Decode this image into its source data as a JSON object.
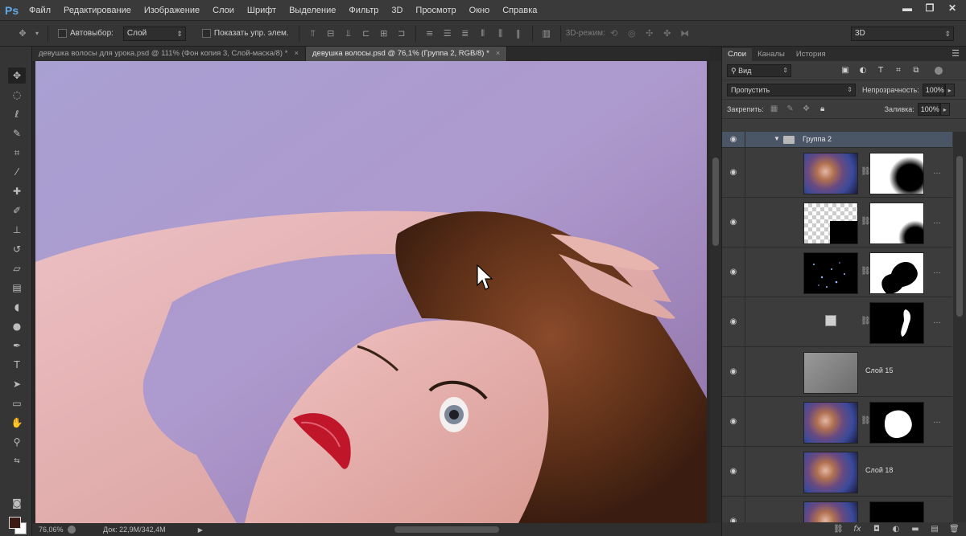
{
  "app": {
    "logo": "Ps"
  },
  "menu": [
    "Файл",
    "Редактирование",
    "Изображение",
    "Слои",
    "Шрифт",
    "Выделение",
    "Фильтр",
    "3D",
    "Просмотр",
    "Окно",
    "Справка"
  ],
  "window_controls": {
    "minimize": "▬",
    "restore": "❐",
    "close": "✕"
  },
  "options": {
    "autoselect_label": "Автовыбор:",
    "autoselect_value": "Слой",
    "show_controls_label": "Показать упр. элем.",
    "mode3d_label": "3D-режим:",
    "workspace_value": "3D"
  },
  "tabs": [
    {
      "label": "девушка волосы для урока.psd @ 111% (Фон копия 3, Слой-маска/8) *",
      "close": "×",
      "active": false
    },
    {
      "label": "девушка волосы.psd @ 76,1% (Группа 2, RGB/8) *",
      "close": "×",
      "active": true
    }
  ],
  "status": {
    "zoom": "76,06%",
    "doc": "Док: 22,9M/342,4M"
  },
  "panel": {
    "tabs": [
      "Слои",
      "Каналы",
      "История"
    ],
    "filter_value": "Вид",
    "blend_mode": "Пропустить",
    "opacity_label": "Непрозрачность:",
    "opacity_value": "100%",
    "lock_label": "Закрепить:",
    "fill_label": "Заливка:",
    "fill_value": "100%"
  },
  "layers": {
    "group_name": "Группа 2",
    "items": [
      {
        "name": ""
      },
      {
        "name": ""
      },
      {
        "name": ""
      },
      {
        "name": ""
      },
      {
        "name": "Слой 15"
      },
      {
        "name": ""
      },
      {
        "name": "Слой 18"
      },
      {
        "name": ""
      }
    ]
  },
  "colors": {
    "foreground": "#3b1a12",
    "background": "#ffffff",
    "accent": "#4a5566"
  }
}
